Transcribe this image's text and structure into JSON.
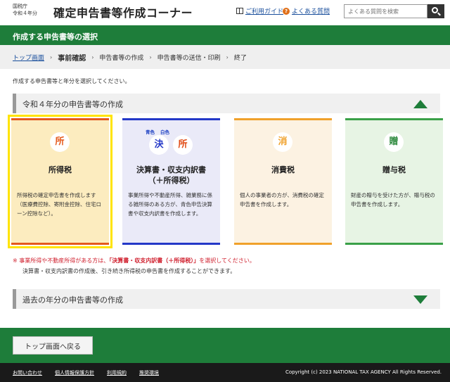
{
  "header": {
    "agency_line1": "国税庁",
    "agency_line2": "令和４年分",
    "site_title": "確定申告書等作成コーナー",
    "guide_link": "ご利用ガイド",
    "faq_link": "よくある質問",
    "search_placeholder": "よくある質問を検索"
  },
  "page_title": "作成する申告書等の選択",
  "breadcrumb": {
    "top": "トップ画面",
    "current": "事前確認",
    "step2": "申告書等の作成",
    "step3": "申告書等の送信・印刷",
    "step4": "終了"
  },
  "instruction": "作成する申告書等と年分を選択してください。",
  "section_current": "令和４年分の申告書等の作成",
  "section_past": "過去の年分の申告書等の作成",
  "cards": [
    {
      "badge": "所",
      "name": "所得税",
      "desc": "所得税の確定申告書を作成します（医療費控除、寄附金控除、住宅ローン控除など）。",
      "bg": "#fcecbf",
      "accent": "#e55a1d",
      "badge_color": "#e55a1d"
    },
    {
      "badge": "決",
      "badge2": "所",
      "mini1": "青色",
      "mini2": "白色",
      "name_line1": "決算書・収支内訳書",
      "name_line2": "（＋所得税）",
      "desc": "事業所得や不動産所得、雑業務に係る雑所得のある方が、青色申告決算書や収支内訳書を作成します。",
      "bg": "#eaeaf8",
      "accent": "#2438c8",
      "badge_color": "#2438c8",
      "badge2_color": "#e04a14"
    },
    {
      "badge": "消",
      "name": "消費税",
      "desc": "個人の事業者の方が、消費税の確定申告書を作成します。",
      "bg": "#fcf2e2",
      "accent": "#f0a12b",
      "badge_color": "#f0a12b"
    },
    {
      "badge": "贈",
      "name": "贈与税",
      "desc": "財産の贈与を受けた方が、贈与税の申告書を作成します。",
      "bg": "#e7f4e4",
      "accent": "#3aa048",
      "badge_color": "#2e8a3e"
    }
  ],
  "note": {
    "mark": "※",
    "pre": "事業所得や不動産所得がある方は、",
    "highlight": "「決算書・収支内訳書（＋所得税）」",
    "post": "を選択してください。",
    "line2": "決算書・収支内訳書の作成後、引き続き所得税の申告書を作成することができます。"
  },
  "back_button": "トップ画面へ戻る",
  "footer": {
    "links": [
      "お問い合わせ",
      "個人情報保護方針",
      "利用規約",
      "推奨環境"
    ],
    "copyright": "Copyright (c) 2023 NATIONAL TAX AGENCY All Rights Reserved."
  },
  "colors": {
    "brand_green": "#1e7d3a",
    "selected_outline": "#ffe400",
    "note_red": "#d0212f"
  }
}
